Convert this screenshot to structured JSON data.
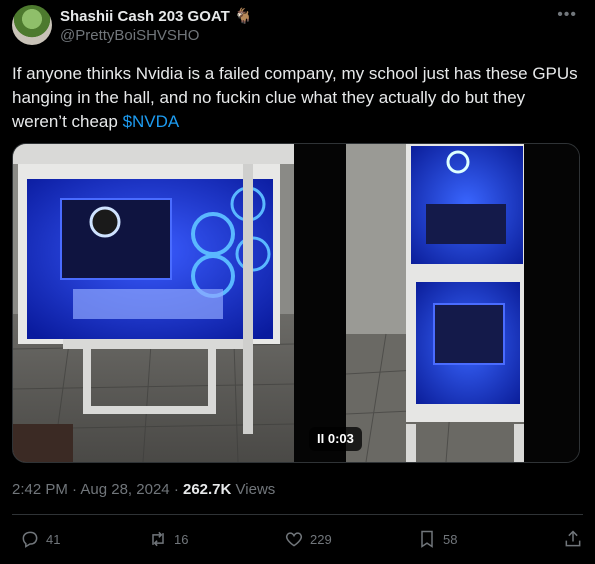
{
  "author": {
    "display_name": "Shashii Cash 203 GOAT 🐐",
    "handle": "@PrettyBoiSHVSHO"
  },
  "tweet": {
    "text_main": "If anyone thinks Nvidia is a failed company, my school just has these GPUs hanging in the hall, and no fuckin clue what they actually do but they weren’t cheap ",
    "cashtag": "$NVDA",
    "time": "2:42 PM",
    "date": "Aug 28, 2024",
    "separator": "·",
    "views_count": "262.7K",
    "views_label": "Views",
    "video_time": "II 0:03"
  },
  "actions": {
    "replies": "41",
    "reposts": "16",
    "likes": "229",
    "bookmarks": "58"
  },
  "icons": [
    "more-icon",
    "reply-icon",
    "repost-icon",
    "like-icon",
    "bookmark-icon",
    "share-icon"
  ],
  "colors": {
    "background": "#000000",
    "text": "#e7e9ea",
    "muted": "#71767b",
    "link": "#1d9bf0",
    "border": "#2f3336"
  }
}
